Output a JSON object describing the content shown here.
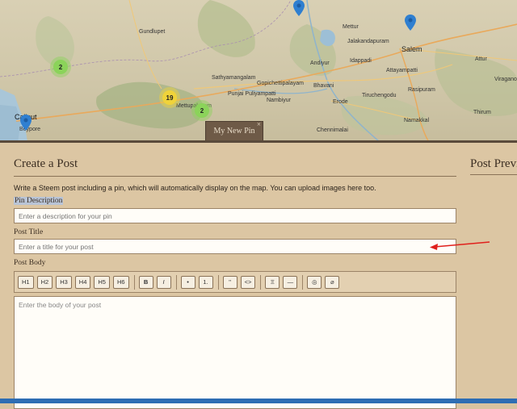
{
  "map": {
    "cities": [
      {
        "name": "Gundlupet"
      },
      {
        "name": "Sathyamangalam"
      },
      {
        "name": "Gopichettipalayam"
      },
      {
        "name": "Bhavani"
      },
      {
        "name": "Punjai Puliyampatti"
      },
      {
        "name": "Nambiyur"
      },
      {
        "name": "Mettur"
      },
      {
        "name": "Jalakandapuram"
      },
      {
        "name": "Idappadi"
      },
      {
        "name": "Andiyur"
      },
      {
        "name": "Salem"
      },
      {
        "name": "Attayampatti"
      },
      {
        "name": "Rasipuram"
      },
      {
        "name": "Attur"
      },
      {
        "name": "Viragano"
      },
      {
        "name": "Tiruchengodu"
      },
      {
        "name": "Erode"
      },
      {
        "name": "Namakkal"
      },
      {
        "name": "Chennimalai"
      },
      {
        "name": "Thirum"
      },
      {
        "name": "Calicut"
      },
      {
        "name": "Beypore"
      },
      {
        "name": "Mettupalayam"
      }
    ],
    "clusters": [
      {
        "count": "2",
        "color": "green"
      },
      {
        "count": "19",
        "color": "yellow"
      },
      {
        "count": "2",
        "color": "green"
      }
    ],
    "pin_color": "#2f7fd0",
    "tab_label": "My New Pin",
    "tab_close": "×"
  },
  "form": {
    "title": "Create a Post",
    "description": "Write a Steem post including a pin, which will automatically display on the map. You can upload images here too.",
    "pin_description": {
      "label": "Pin Description",
      "placeholder": "Enter a description for your pin"
    },
    "post_title": {
      "label": "Post Title",
      "placeholder": "Enter a title for your post"
    },
    "post_body": {
      "label": "Post Body",
      "placeholder": "Enter the body of your post"
    },
    "toolbar": {
      "h1": "H1",
      "h2": "H2",
      "h3": "H3",
      "h4": "H4",
      "h5": "H5",
      "h6": "H6",
      "bold": "B",
      "italic": "I",
      "bullet": "•",
      "numbered": "1.",
      "quote": "\"",
      "code": "<>",
      "center": "Ξ",
      "hr": "—",
      "image": "◎",
      "link": "⌀"
    }
  },
  "preview": {
    "title": "Post Previ"
  },
  "annotation": {
    "arrow_color": "#e0201c"
  }
}
